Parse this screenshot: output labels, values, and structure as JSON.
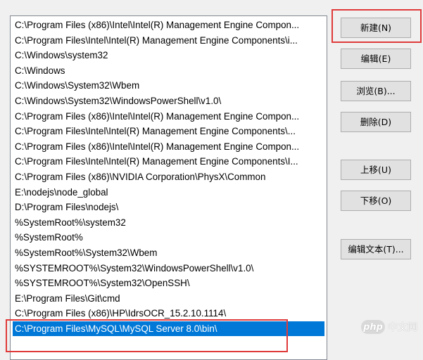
{
  "path_list": {
    "items": [
      "C:\\Program Files (x86)\\Intel\\Intel(R) Management Engine Compon...",
      "C:\\Program Files\\Intel\\Intel(R) Management Engine Components\\i...",
      "C:\\Windows\\system32",
      "C:\\Windows",
      "C:\\Windows\\System32\\Wbem",
      "C:\\Windows\\System32\\WindowsPowerShell\\v1.0\\",
      "C:\\Program Files (x86)\\Intel\\Intel(R) Management Engine Compon...",
      "C:\\Program Files\\Intel\\Intel(R) Management Engine Components\\...",
      "C:\\Program Files (x86)\\Intel\\Intel(R) Management Engine Compon...",
      "C:\\Program Files\\Intel\\Intel(R) Management Engine Components\\I...",
      "C:\\Program Files (x86)\\NVIDIA Corporation\\PhysX\\Common",
      "E:\\nodejs\\node_global",
      "D:\\Program Files\\nodejs\\",
      "%SystemRoot%\\system32",
      "%SystemRoot%",
      "%SystemRoot%\\System32\\Wbem",
      "%SYSTEMROOT%\\System32\\WindowsPowerShell\\v1.0\\",
      "%SYSTEMROOT%\\System32\\OpenSSH\\",
      "E:\\Program Files\\Git\\cmd",
      "C:\\Program Files (x86)\\HP\\IdrsOCR_15.2.10.1114\\",
      "C:\\Program Files\\MySQL\\MySQL Server 8.0\\bin\\"
    ],
    "selected_index": 20
  },
  "buttons": {
    "new": "新建(N)",
    "edit": "编辑(E)",
    "browse": "浏览(B)...",
    "delete": "删除(D)",
    "move_up": "上移(U)",
    "move_down": "下移(O)",
    "edit_text": "编辑文本(T)..."
  },
  "watermark": {
    "logo": "php",
    "text": "中文网"
  },
  "colors": {
    "selection": "#0078d7",
    "highlight_box": "#e03a3a"
  }
}
